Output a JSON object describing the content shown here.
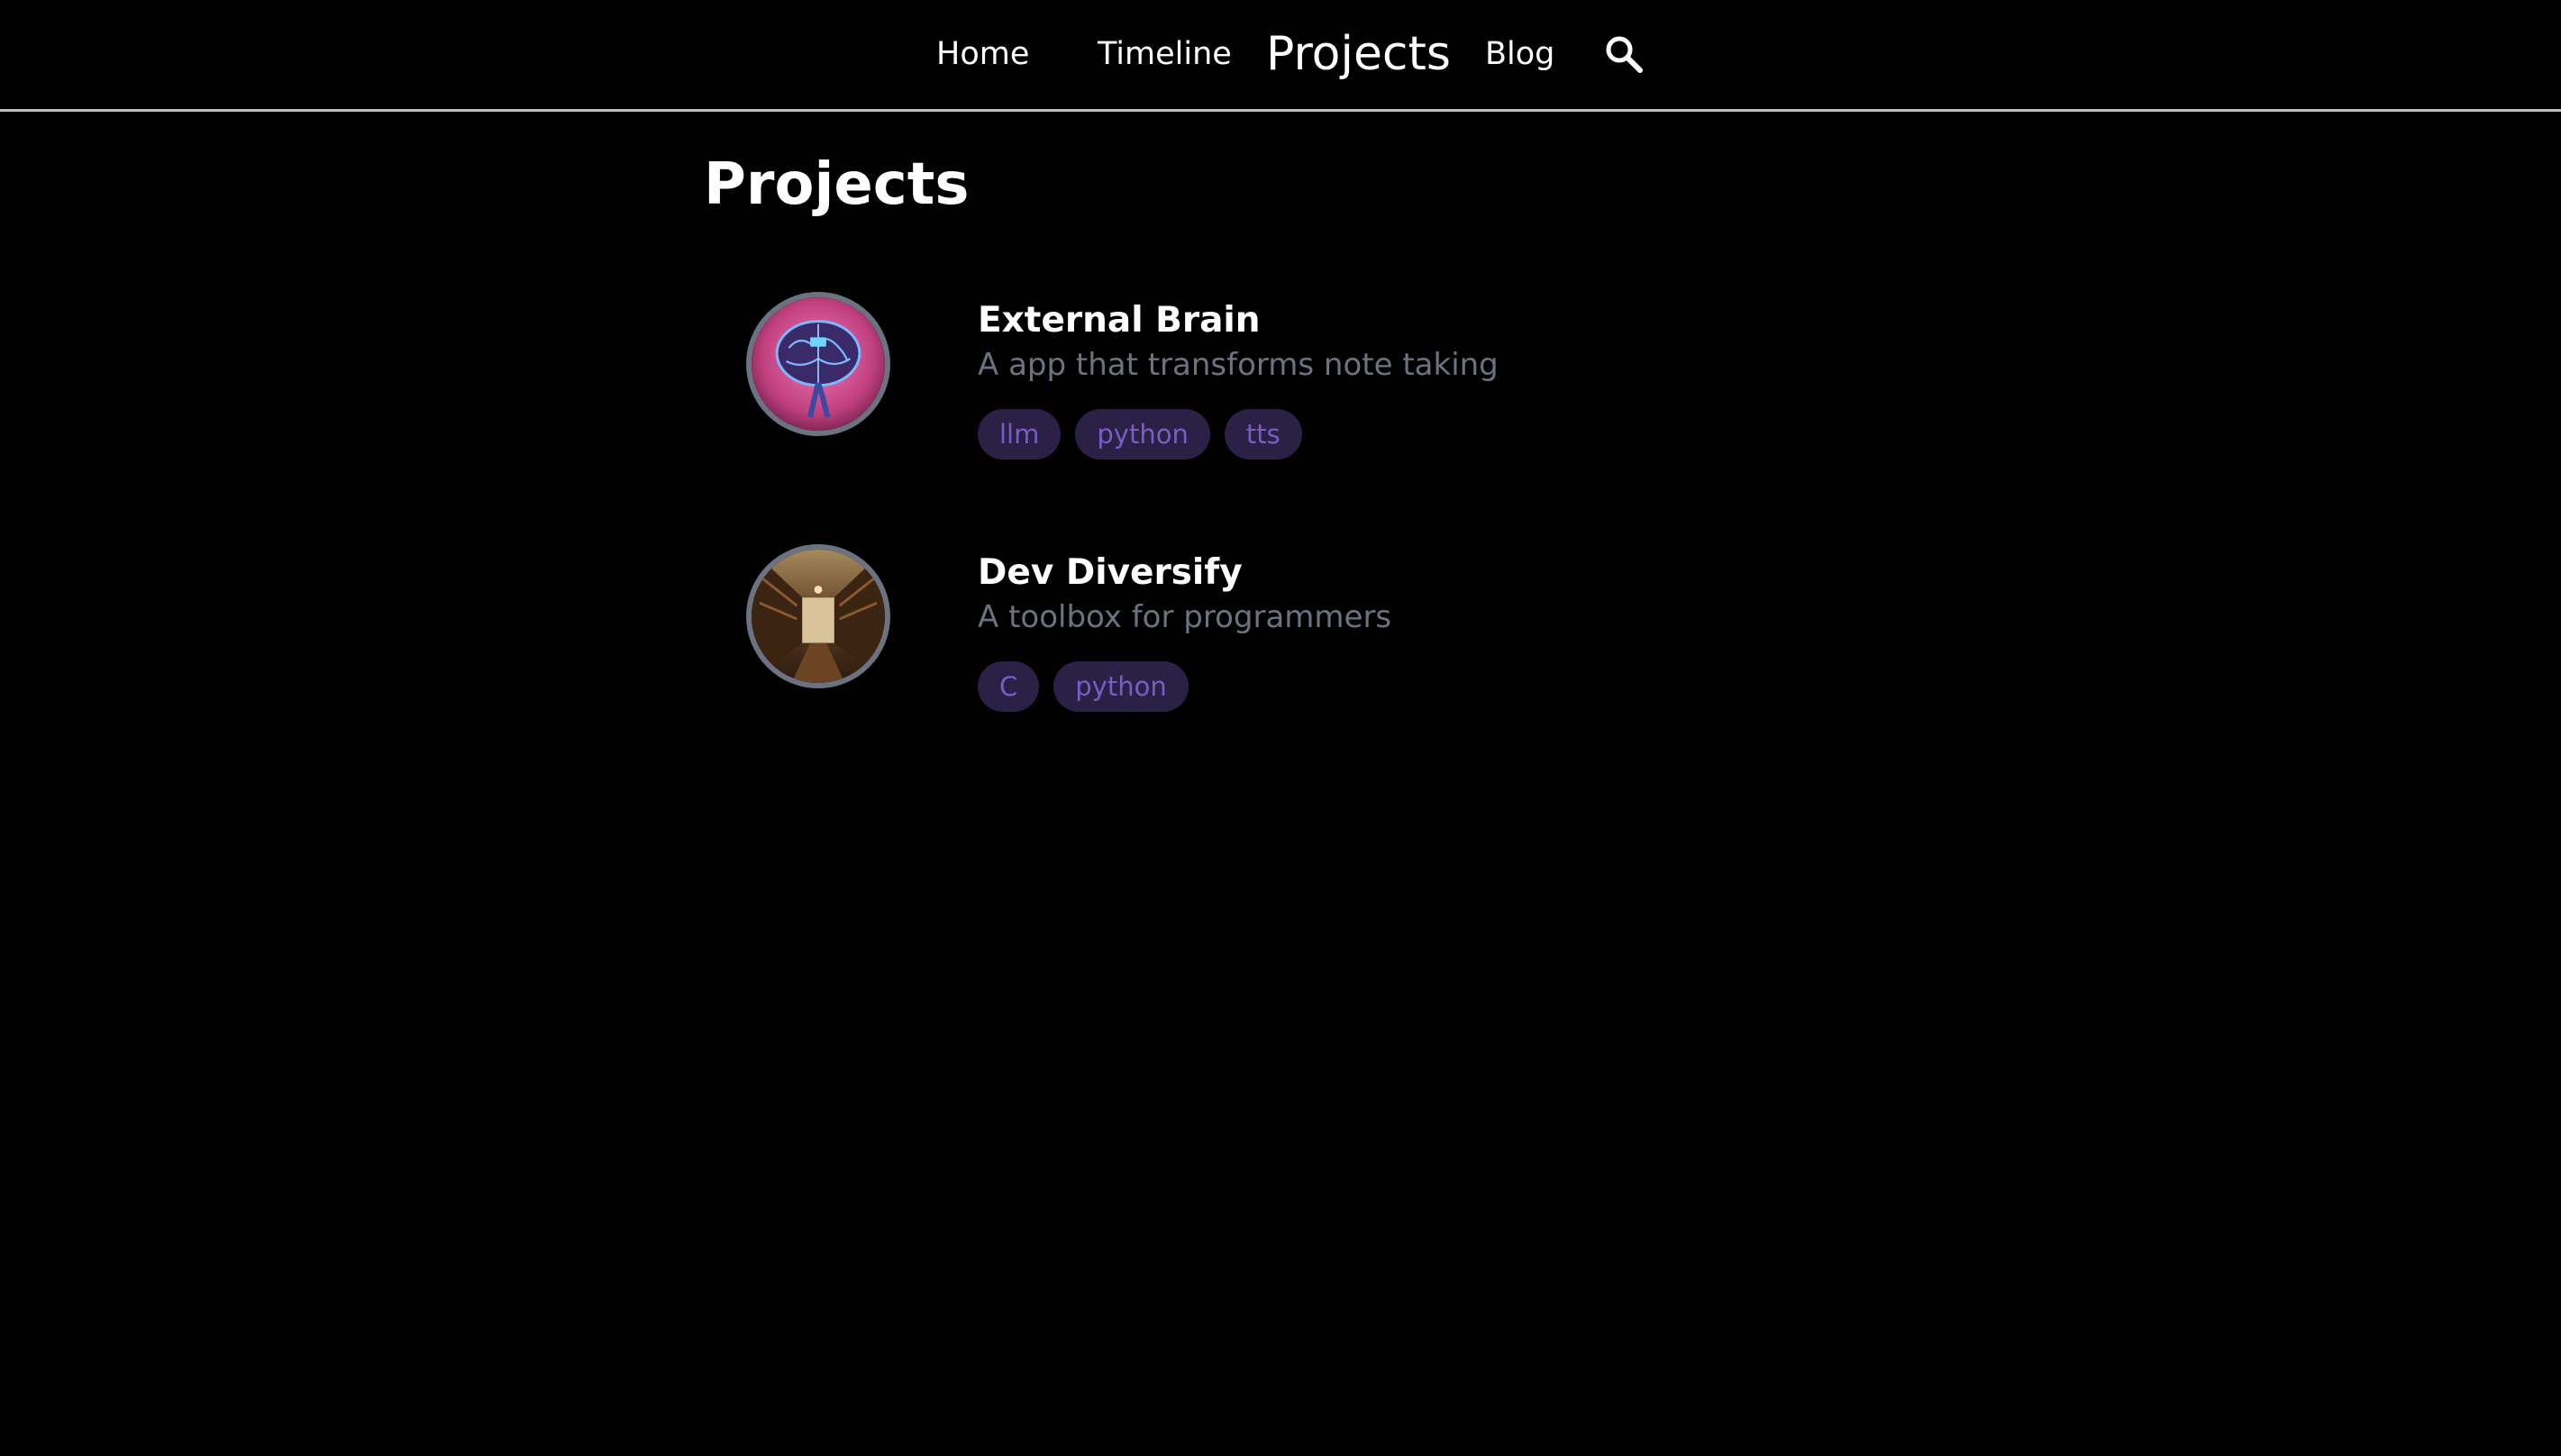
{
  "nav": {
    "home": "Home",
    "timeline": "Timeline",
    "projects": "Projects",
    "blog": "Blog",
    "search_icon": "search-icon"
  },
  "page": {
    "title": "Projects"
  },
  "projects": [
    {
      "title": "External Brain",
      "description": "A app that transforms note taking",
      "image_icon": "brain-image",
      "tags": [
        "llm",
        "python",
        "tts"
      ]
    },
    {
      "title": "Dev Diversify",
      "description": "A toolbox for programmers",
      "image_icon": "library-image",
      "tags": [
        "C",
        "python"
      ]
    }
  ],
  "colors": {
    "background": "#000000",
    "text": "#ffffff",
    "muted_text": "#6b7280",
    "tag_background": "#2b2147",
    "tag_text": "#7c5cc4",
    "nav_divider": "#bfbfbf"
  }
}
